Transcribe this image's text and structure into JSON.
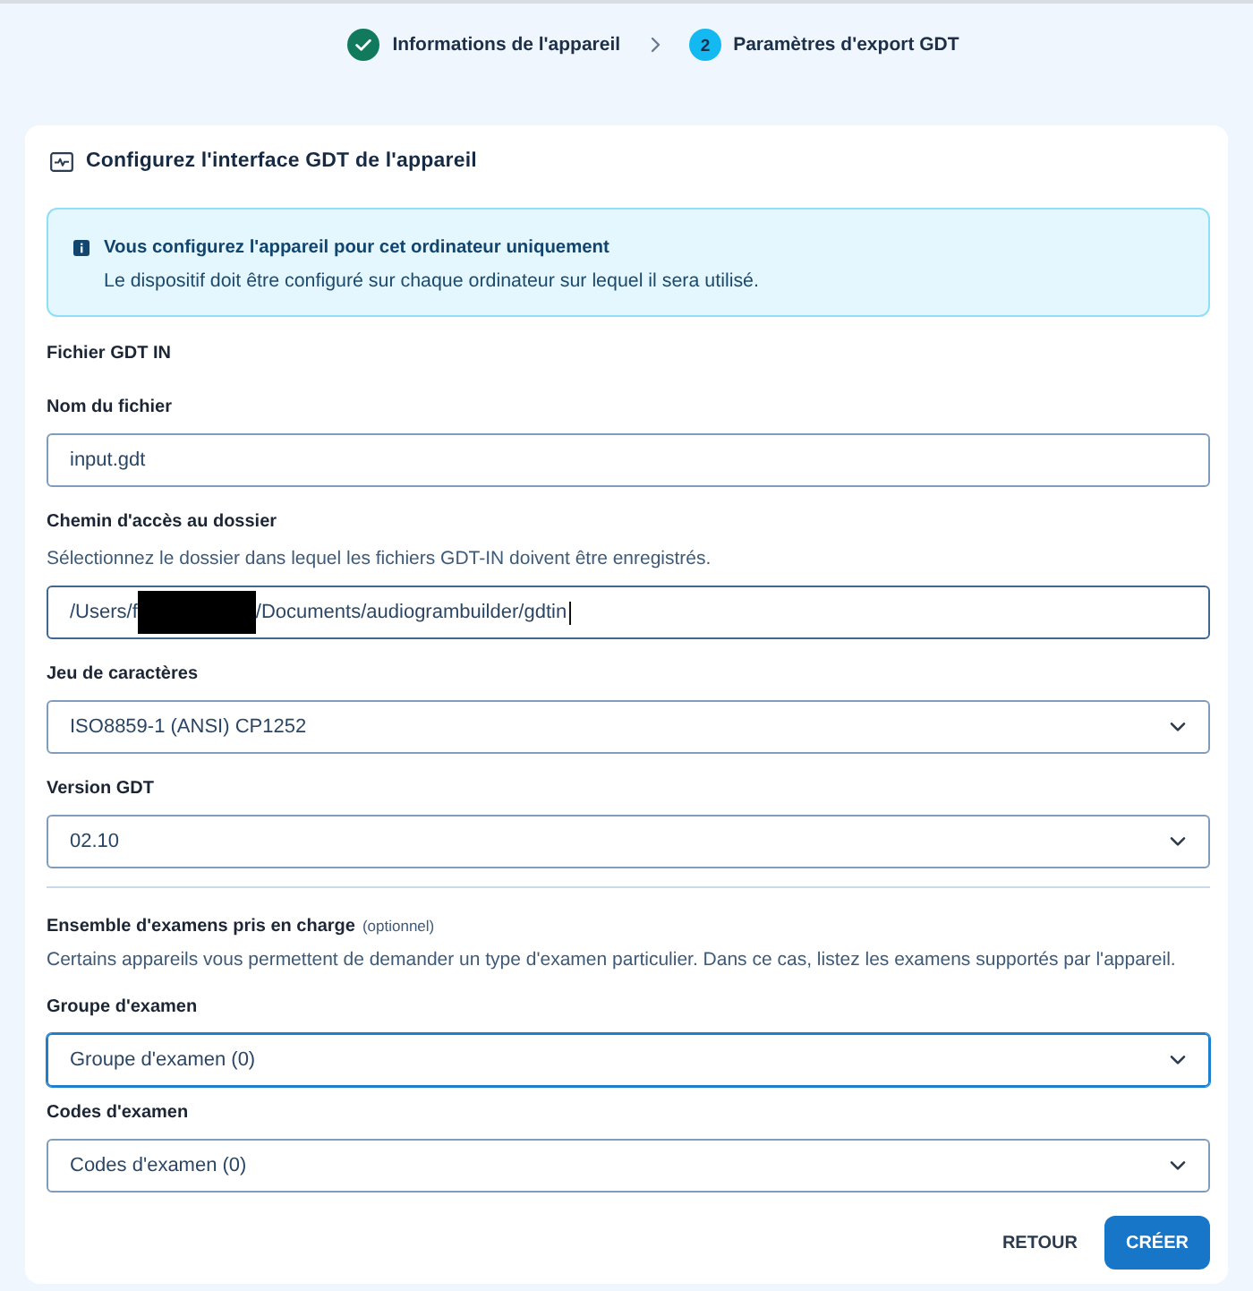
{
  "stepper": {
    "steps": [
      {
        "kind": "done",
        "label": "Informations de l'appareil"
      },
      {
        "kind": "current",
        "number": "2",
        "label": "Paramètres d'export GDT"
      }
    ]
  },
  "card": {
    "title": "Configurez l'interface GDT de l'appareil",
    "info": {
      "title": "Vous configurez l'appareil pour cet ordinateur uniquement",
      "text": "Le dispositif doit être configuré sur chaque ordinateur sur lequel il sera utilisé."
    },
    "section_title": "Fichier GDT IN",
    "fields": [
      {
        "kind": "text",
        "label": "Nom du fichier",
        "value": "input.gdt",
        "focused": false
      },
      {
        "kind": "path",
        "label": "Chemin d'accès au dossier",
        "helper": "Sélectionnez le dossier dans lequel les fichiers GDT-IN doivent être enregistrés.",
        "value_parts": [
          "/Users/f",
          "/Documents/audiogrambuilder/gdtin"
        ],
        "redacted": true,
        "focused": true
      },
      {
        "kind": "select",
        "label": "Jeu de caractères",
        "value": "ISO8859-1 (ANSI) CP1252",
        "focused": false
      },
      {
        "kind": "select",
        "label": "Version GDT",
        "value": "02.10",
        "focused": false
      }
    ],
    "exam_section": {
      "title": "Ensemble d'examens pris en charge",
      "optional": "(optionnel)",
      "helper": "Certains appareils vous permettent de demander un type d'examen particulier. Dans ce cas, listez les examens supportés par l'appareil."
    },
    "exam_fields": [
      {
        "kind": "select",
        "label": "Groupe d'examen",
        "value": "Groupe d'examen (0)",
        "focused": true
      },
      {
        "kind": "select",
        "label": "Codes d'examen",
        "value": "Codes d'examen (0)",
        "focused": false
      }
    ],
    "buttons": [
      {
        "kind": "text",
        "label": "RETOUR"
      },
      {
        "kind": "primary",
        "label": "CRÉER"
      }
    ]
  }
}
